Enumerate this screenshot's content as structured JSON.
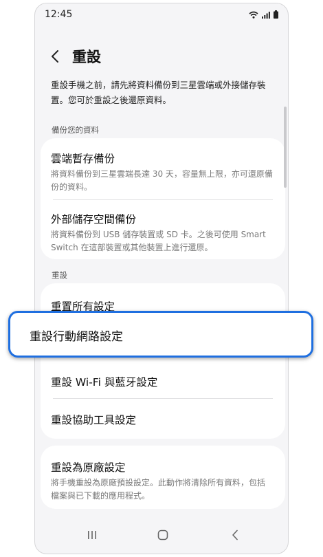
{
  "status_bar": {
    "time": "12:45",
    "icons": [
      "wifi-icon",
      "signal-icon",
      "battery-icon"
    ]
  },
  "header": {
    "back_icon": "chevron-left-icon",
    "title": "重設"
  },
  "description": {
    "line1": "重設手機之前，請先將資料備份到三星雲端或外接儲存裝",
    "line2": "置。您可於重設之後還原資料。"
  },
  "backup_section": {
    "label": "備份您的資料",
    "items": [
      {
        "title": "雲端暫存備份",
        "sub_line1": "將資料備份到三星雲端長達 30 天，容量無上限，亦可還原備",
        "sub_line2": "份的資料。"
      },
      {
        "title": "外部儲存空間備份",
        "sub_line1": "將資料備份到 USB 儲存裝置或 SD 卡。之後可使用 Smart",
        "sub_line2": "Switch 在這部裝置或其他裝置上進行還原。"
      }
    ]
  },
  "reset_section": {
    "label": "重設",
    "items": [
      {
        "title": "重置所有設定"
      },
      {
        "title": "重設行動網路設定"
      },
      {
        "title": "重設 Wi-Fi 與藍牙設定"
      },
      {
        "title": "重設協助工具設定"
      }
    ]
  },
  "factory_reset": {
    "title": "重設為原廠設定",
    "sub_line1": "將手機重設為原廠預設設定。此動作將清除所有資料，包括",
    "sub_line2": "檔案與已下載的應用程式。"
  },
  "nav_bar": {
    "icons": [
      "recents-icon",
      "home-icon",
      "back-icon"
    ]
  },
  "colors": {
    "highlight_border": "#1f6fe0",
    "screen_bg": "#f5f5f7"
  }
}
